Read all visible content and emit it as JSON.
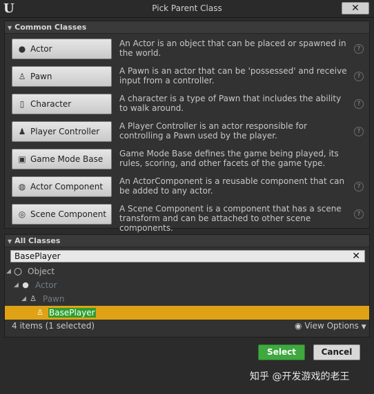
{
  "window": {
    "title": "Pick Parent Class",
    "close_label": "✕"
  },
  "common": {
    "header": "Common Classes",
    "items": [
      {
        "label": "Actor",
        "icon": "actor-icon",
        "desc": "An Actor is an object that can be placed or spawned in the world."
      },
      {
        "label": "Pawn",
        "icon": "pawn-icon",
        "desc": "A Pawn is an actor that can be 'possessed' and receive input from a controller."
      },
      {
        "label": "Character",
        "icon": "character-icon",
        "desc": "A character is a type of Pawn that includes the ability to walk around."
      },
      {
        "label": "Player Controller",
        "icon": "player-controller-icon",
        "desc": "A Player Controller is an actor responsible for controlling a Pawn used by the player."
      },
      {
        "label": "Game Mode Base",
        "icon": "game-mode-icon",
        "desc": "Game Mode Base defines the game being played, its rules, scoring, and other facets of the game type."
      },
      {
        "label": "Actor Component",
        "icon": "actor-component-icon",
        "desc": "An ActorComponent is a reusable component that can be added to any actor."
      },
      {
        "label": "Scene Component",
        "icon": "scene-component-icon",
        "desc": "A Scene Component is a component that has a scene transform and can be attached to other scene components."
      }
    ]
  },
  "all": {
    "header": "All Classes",
    "search_value": "BasePlayer",
    "tree": [
      {
        "label": "Object",
        "depth": 0,
        "icon": "object-icon"
      },
      {
        "label": "Actor",
        "depth": 1,
        "icon": "actor-icon"
      },
      {
        "label": "Pawn",
        "depth": 2,
        "icon": "pawn-icon"
      },
      {
        "label": "BasePlayer",
        "depth": 3,
        "icon": "pawn-icon",
        "selected": true
      }
    ],
    "status": "4 items (1 selected)",
    "view_options": "View Options"
  },
  "footer": {
    "select_label": "Select",
    "cancel_label": "Cancel"
  },
  "watermark": "知乎 @开发游戏的老王",
  "colors": {
    "selected_row": "#e0a215",
    "highlight": "#2f9e2f",
    "select_button": "#3fa83f"
  }
}
